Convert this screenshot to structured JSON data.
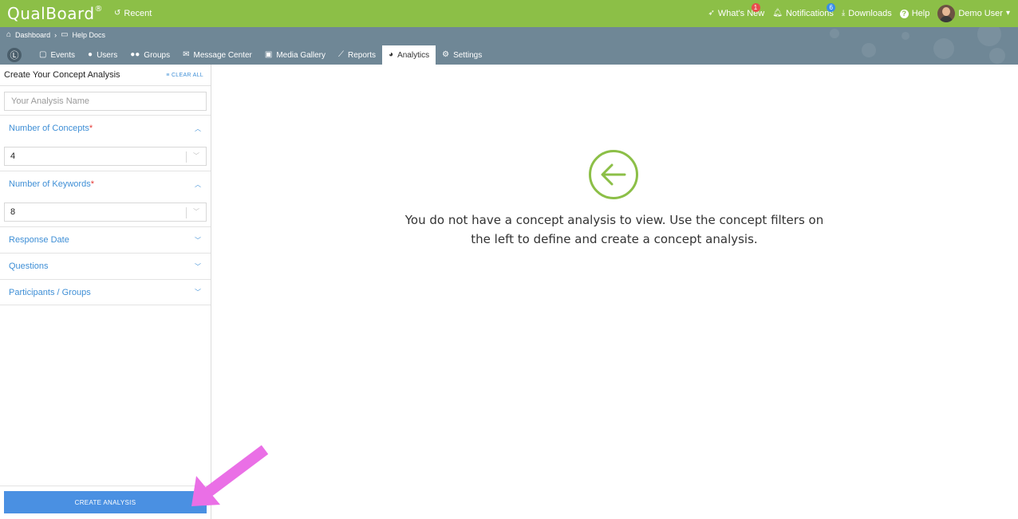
{
  "app": {
    "brand": "QualBoard",
    "brand_mark": "®",
    "recent_label": "Recent"
  },
  "topnav": {
    "whats_new": "What's New",
    "whats_new_badge": "1",
    "notifications": "Notifications",
    "notifications_badge": "6",
    "downloads": "Downloads",
    "help": "Help",
    "user": "Demo User"
  },
  "breadcrumb": {
    "items": [
      "Dashboard",
      "Help Docs"
    ]
  },
  "tabs": [
    {
      "label": "Events",
      "icon": "calendar-icon"
    },
    {
      "label": "Users",
      "icon": "user-icon"
    },
    {
      "label": "Groups",
      "icon": "users-icon"
    },
    {
      "label": "Message Center",
      "icon": "envelope-icon"
    },
    {
      "label": "Media Gallery",
      "icon": "images-icon"
    },
    {
      "label": "Reports",
      "icon": "chart-line-icon"
    },
    {
      "label": "Analytics",
      "icon": "pie-chart-icon",
      "active": true
    },
    {
      "label": "Settings",
      "icon": "gear-icon"
    }
  ],
  "sidebar": {
    "title": "Create Your Concept Analysis",
    "clear_all": "CLEAR ALL",
    "name_placeholder": "Your Analysis Name",
    "concepts_label": "Number of Concepts",
    "concepts_value": "4",
    "keywords_label": "Number of Keywords",
    "keywords_value": "8",
    "required_mark": "*",
    "response_date_label": "Response Date",
    "questions_label": "Questions",
    "participants_label": "Participants / Groups",
    "create_button": "CREATE ANALYSIS"
  },
  "main": {
    "empty_message": "You do not have a concept analysis to view. Use the concept filters on the left to define and create a concept analysis."
  },
  "colors": {
    "topbar": "#8cbf47",
    "navstrip": "#6f8796",
    "accent_blue": "#3f8fd6",
    "button_blue": "#4a90e2",
    "annotation_arrow": "#ea6fe6",
    "empty_icon": "#8cbf47"
  }
}
